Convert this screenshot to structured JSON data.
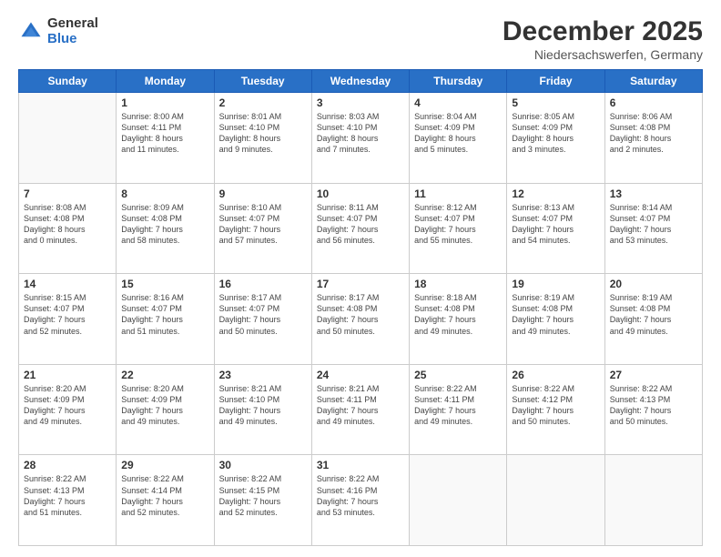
{
  "logo": {
    "general": "General",
    "blue": "Blue"
  },
  "header": {
    "title": "December 2025",
    "subtitle": "Niedersachswerfen, Germany"
  },
  "weekdays": [
    "Sunday",
    "Monday",
    "Tuesday",
    "Wednesday",
    "Thursday",
    "Friday",
    "Saturday"
  ],
  "weeks": [
    [
      {
        "day": "",
        "info": ""
      },
      {
        "day": "1",
        "info": "Sunrise: 8:00 AM\nSunset: 4:11 PM\nDaylight: 8 hours\nand 11 minutes."
      },
      {
        "day": "2",
        "info": "Sunrise: 8:01 AM\nSunset: 4:10 PM\nDaylight: 8 hours\nand 9 minutes."
      },
      {
        "day": "3",
        "info": "Sunrise: 8:03 AM\nSunset: 4:10 PM\nDaylight: 8 hours\nand 7 minutes."
      },
      {
        "day": "4",
        "info": "Sunrise: 8:04 AM\nSunset: 4:09 PM\nDaylight: 8 hours\nand 5 minutes."
      },
      {
        "day": "5",
        "info": "Sunrise: 8:05 AM\nSunset: 4:09 PM\nDaylight: 8 hours\nand 3 minutes."
      },
      {
        "day": "6",
        "info": "Sunrise: 8:06 AM\nSunset: 4:08 PM\nDaylight: 8 hours\nand 2 minutes."
      }
    ],
    [
      {
        "day": "7",
        "info": "Sunrise: 8:08 AM\nSunset: 4:08 PM\nDaylight: 8 hours\nand 0 minutes."
      },
      {
        "day": "8",
        "info": "Sunrise: 8:09 AM\nSunset: 4:08 PM\nDaylight: 7 hours\nand 58 minutes."
      },
      {
        "day": "9",
        "info": "Sunrise: 8:10 AM\nSunset: 4:07 PM\nDaylight: 7 hours\nand 57 minutes."
      },
      {
        "day": "10",
        "info": "Sunrise: 8:11 AM\nSunset: 4:07 PM\nDaylight: 7 hours\nand 56 minutes."
      },
      {
        "day": "11",
        "info": "Sunrise: 8:12 AM\nSunset: 4:07 PM\nDaylight: 7 hours\nand 55 minutes."
      },
      {
        "day": "12",
        "info": "Sunrise: 8:13 AM\nSunset: 4:07 PM\nDaylight: 7 hours\nand 54 minutes."
      },
      {
        "day": "13",
        "info": "Sunrise: 8:14 AM\nSunset: 4:07 PM\nDaylight: 7 hours\nand 53 minutes."
      }
    ],
    [
      {
        "day": "14",
        "info": "Sunrise: 8:15 AM\nSunset: 4:07 PM\nDaylight: 7 hours\nand 52 minutes."
      },
      {
        "day": "15",
        "info": "Sunrise: 8:16 AM\nSunset: 4:07 PM\nDaylight: 7 hours\nand 51 minutes."
      },
      {
        "day": "16",
        "info": "Sunrise: 8:17 AM\nSunset: 4:07 PM\nDaylight: 7 hours\nand 50 minutes."
      },
      {
        "day": "17",
        "info": "Sunrise: 8:17 AM\nSunset: 4:08 PM\nDaylight: 7 hours\nand 50 minutes."
      },
      {
        "day": "18",
        "info": "Sunrise: 8:18 AM\nSunset: 4:08 PM\nDaylight: 7 hours\nand 49 minutes."
      },
      {
        "day": "19",
        "info": "Sunrise: 8:19 AM\nSunset: 4:08 PM\nDaylight: 7 hours\nand 49 minutes."
      },
      {
        "day": "20",
        "info": "Sunrise: 8:19 AM\nSunset: 4:08 PM\nDaylight: 7 hours\nand 49 minutes."
      }
    ],
    [
      {
        "day": "21",
        "info": "Sunrise: 8:20 AM\nSunset: 4:09 PM\nDaylight: 7 hours\nand 49 minutes."
      },
      {
        "day": "22",
        "info": "Sunrise: 8:20 AM\nSunset: 4:09 PM\nDaylight: 7 hours\nand 49 minutes."
      },
      {
        "day": "23",
        "info": "Sunrise: 8:21 AM\nSunset: 4:10 PM\nDaylight: 7 hours\nand 49 minutes."
      },
      {
        "day": "24",
        "info": "Sunrise: 8:21 AM\nSunset: 4:11 PM\nDaylight: 7 hours\nand 49 minutes."
      },
      {
        "day": "25",
        "info": "Sunrise: 8:22 AM\nSunset: 4:11 PM\nDaylight: 7 hours\nand 49 minutes."
      },
      {
        "day": "26",
        "info": "Sunrise: 8:22 AM\nSunset: 4:12 PM\nDaylight: 7 hours\nand 50 minutes."
      },
      {
        "day": "27",
        "info": "Sunrise: 8:22 AM\nSunset: 4:13 PM\nDaylight: 7 hours\nand 50 minutes."
      }
    ],
    [
      {
        "day": "28",
        "info": "Sunrise: 8:22 AM\nSunset: 4:13 PM\nDaylight: 7 hours\nand 51 minutes."
      },
      {
        "day": "29",
        "info": "Sunrise: 8:22 AM\nSunset: 4:14 PM\nDaylight: 7 hours\nand 52 minutes."
      },
      {
        "day": "30",
        "info": "Sunrise: 8:22 AM\nSunset: 4:15 PM\nDaylight: 7 hours\nand 52 minutes."
      },
      {
        "day": "31",
        "info": "Sunrise: 8:22 AM\nSunset: 4:16 PM\nDaylight: 7 hours\nand 53 minutes."
      },
      {
        "day": "",
        "info": ""
      },
      {
        "day": "",
        "info": ""
      },
      {
        "day": "",
        "info": ""
      }
    ]
  ]
}
